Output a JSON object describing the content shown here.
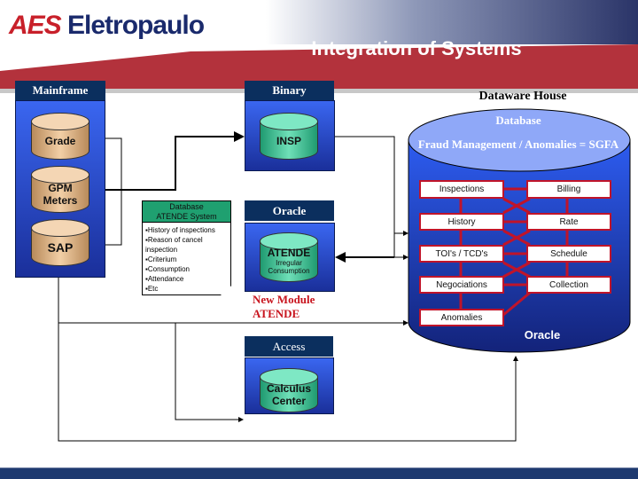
{
  "header": {
    "logo_text": "AES Eletropaulo",
    "title": "Integration of Systems"
  },
  "mainframe": {
    "label": "Mainframe",
    "databases": [
      "Grade",
      "GPM Meters",
      "SAP"
    ]
  },
  "binary": {
    "label": "Binary",
    "database": "INSP"
  },
  "note": {
    "title": "Database ATENDE System",
    "items": [
      "History of inspections",
      "Reason of cancel inspection",
      "Criterium",
      "Consumption",
      "Attendance",
      "Etc"
    ]
  },
  "oracle": {
    "label": "Oracle",
    "database": "ATENDE",
    "subtitle": "Irregular Consumption",
    "new_module": "New Module ATENDE"
  },
  "access": {
    "label": "Access",
    "database": "Calculus Center"
  },
  "dw": {
    "title": "Dataware House",
    "db_label": "Database",
    "db_name": "Fraud Management / Anomalies  = SGFA",
    "footer": "Oracle",
    "left_modules": [
      "Inspections",
      "History",
      "TOI's / TCD's",
      "Negociations",
      "Anomalies"
    ],
    "right_modules": [
      "Billing",
      "Rate",
      "Schedule",
      "Collection"
    ]
  },
  "colors": {
    "header_red": "#b3323c",
    "navy": "#0b2f5e",
    "module_border": "#c0142a",
    "footer_bar": "#1e3a70"
  }
}
